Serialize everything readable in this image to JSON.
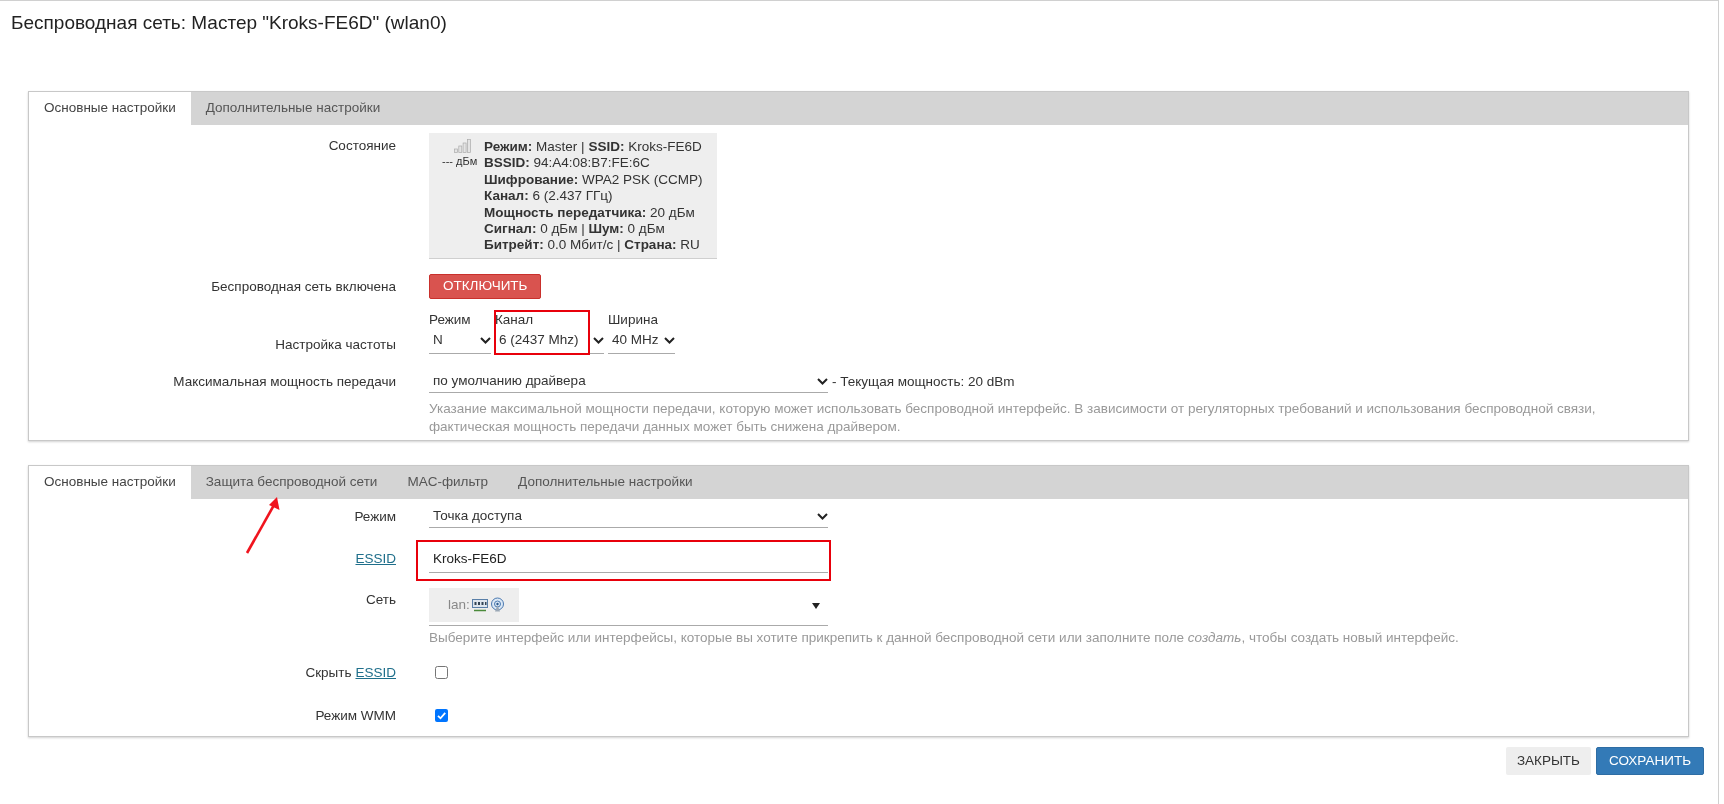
{
  "title": "Беспроводная сеть: Мастер \"Kroks-FE6D\" (wlan0)",
  "panels": [
    {
      "tabs": [
        {
          "label": "Основные настройки",
          "selected": true
        },
        {
          "label": "Дополнительные настройки",
          "selected": false
        }
      ],
      "rows": [
        {
          "kind": "status",
          "label": "Состояние",
          "signal": "--- дБм",
          "lines": [
            "**Режим:** Master | **SSID:** Kroks-FE6D",
            "**BSSID:** 94:A4:08:B7:FE:6C",
            "**Шифрование:** WPA2 PSK (CCMP)",
            "**Канал:** 6 (2.437 ГГц)",
            "**Мощность передатчика:** 20 дБм",
            "**Сигнал:** 0 дБм | **Шум:** 0 дБм",
            "**Битрейт:** 0.0 Мбит/с | **Страна:** RU"
          ]
        },
        {
          "kind": "button",
          "label": "Беспроводная сеть включена",
          "button": "ОТКЛЮЧИТЬ"
        },
        {
          "kind": "multi",
          "label": "Настройка частоты",
          "columns": [
            {
              "label": "Режим",
              "value": "N",
              "highlighted": false
            },
            {
              "label": "Канал",
              "value": "6 (2437 Mhz)",
              "highlighted": true
            },
            {
              "label": "Ширина",
              "value": "40 MHz",
              "highlighted": false
            }
          ]
        },
        {
          "kind": "select",
          "label": "Максимальная мощность передачи",
          "value": "по умолчанию драйвера",
          "suffix": "- Текущая мощность: 20 dBm",
          "help": "Указание максимальной мощности передачи, которую может использовать беспроводной интерфейс. В зависимости от регуляторных требований и использования беспроводной связи, фактическая мощность передачи данных может быть снижена драйвером."
        }
      ]
    },
    {
      "tabs": [
        {
          "label": "Основные настройки",
          "selected": true,
          "pointed": false
        },
        {
          "label": "Защита беспроводной сети",
          "selected": false,
          "pointed": true
        },
        {
          "label": "MAC-фильтр",
          "selected": false,
          "pointed": false
        },
        {
          "label": "Дополнительные настройки",
          "selected": false,
          "pointed": false
        }
      ],
      "rows": [
        {
          "kind": "select",
          "label": "Режим",
          "value": "Точка доступа"
        },
        {
          "kind": "input",
          "link": "ESSID",
          "value": "Kroks-FE6D",
          "highlighted": true
        },
        {
          "kind": "network",
          "label": "Сеть",
          "value": "lan:",
          "help": "Выберите интерфейс или интерфейсы, которые вы хотите прикрепить к данной беспроводной сети или заполните поле *создать*, чтобы создать новый интерфейс."
        },
        {
          "kind": "checkbox",
          "label": "Скрыть",
          "link": "ESSID",
          "checked": false
        },
        {
          "kind": "checkbox",
          "label": "Режим WMM",
          "checked": true
        }
      ]
    }
  ],
  "buttons": [
    {
      "label": "ЗАКРЫТЬ",
      "kind": "secondary"
    },
    {
      "label": "СОХРАНИТЬ",
      "kind": "primary"
    }
  ]
}
